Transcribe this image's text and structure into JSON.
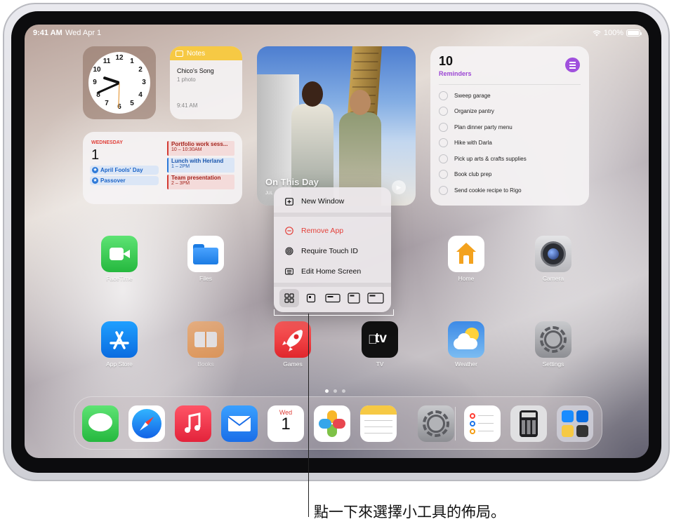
{
  "status": {
    "time": "9:41 AM",
    "date": "Wed Apr 1",
    "battery": "100%"
  },
  "clock": {
    "numbers": [
      "12",
      "1",
      "2",
      "3",
      "4",
      "5",
      "6",
      "7",
      "8",
      "9",
      "10",
      "11"
    ]
  },
  "notes": {
    "header": "Notes",
    "title": "Chico's Song",
    "subtitle": "1 photo",
    "time": "9:41 AM"
  },
  "calendar": {
    "weekday": "WEDNESDAY",
    "day": "1",
    "all_day": [
      "April Fools' Day",
      "Passover"
    ],
    "events": [
      {
        "title": "Portfolio work sess...",
        "time": "10 – 10:30AM"
      },
      {
        "title": "Lunch with Herland",
        "time": "1 – 2PM"
      },
      {
        "title": "Team presentation",
        "time": "2 – 3PM"
      }
    ]
  },
  "photo": {
    "title": "On This Day",
    "subtitle": "JUL"
  },
  "reminders": {
    "count": "10",
    "title": "Reminders",
    "items": [
      "Sweep garage",
      "Organize pantry",
      "Plan dinner party menu",
      "Hike with Darla",
      "Pick up arts & crafts supplies",
      "Book club prep",
      "Send cookie recipe to Rigo"
    ]
  },
  "apps_row1": [
    "FaceTime",
    "Files",
    "",
    "Home",
    "Camera"
  ],
  "apps_row2": [
    "App Store",
    "Books",
    "Games",
    "TV",
    "Weather",
    "Settings"
  ],
  "tv_text": "tv",
  "menu": {
    "new_window": "New Window",
    "remove_app": "Remove App",
    "require_touch_id": "Require Touch ID",
    "edit_home_screen": "Edit Home Screen"
  },
  "dock": {
    "calendar_day": "Wed",
    "calendar_num": "1"
  },
  "callout": "點一下來選擇小工具的佈局。",
  "colors": {
    "accent_purple": "#a050dd",
    "remove_red": "#e4403a"
  }
}
